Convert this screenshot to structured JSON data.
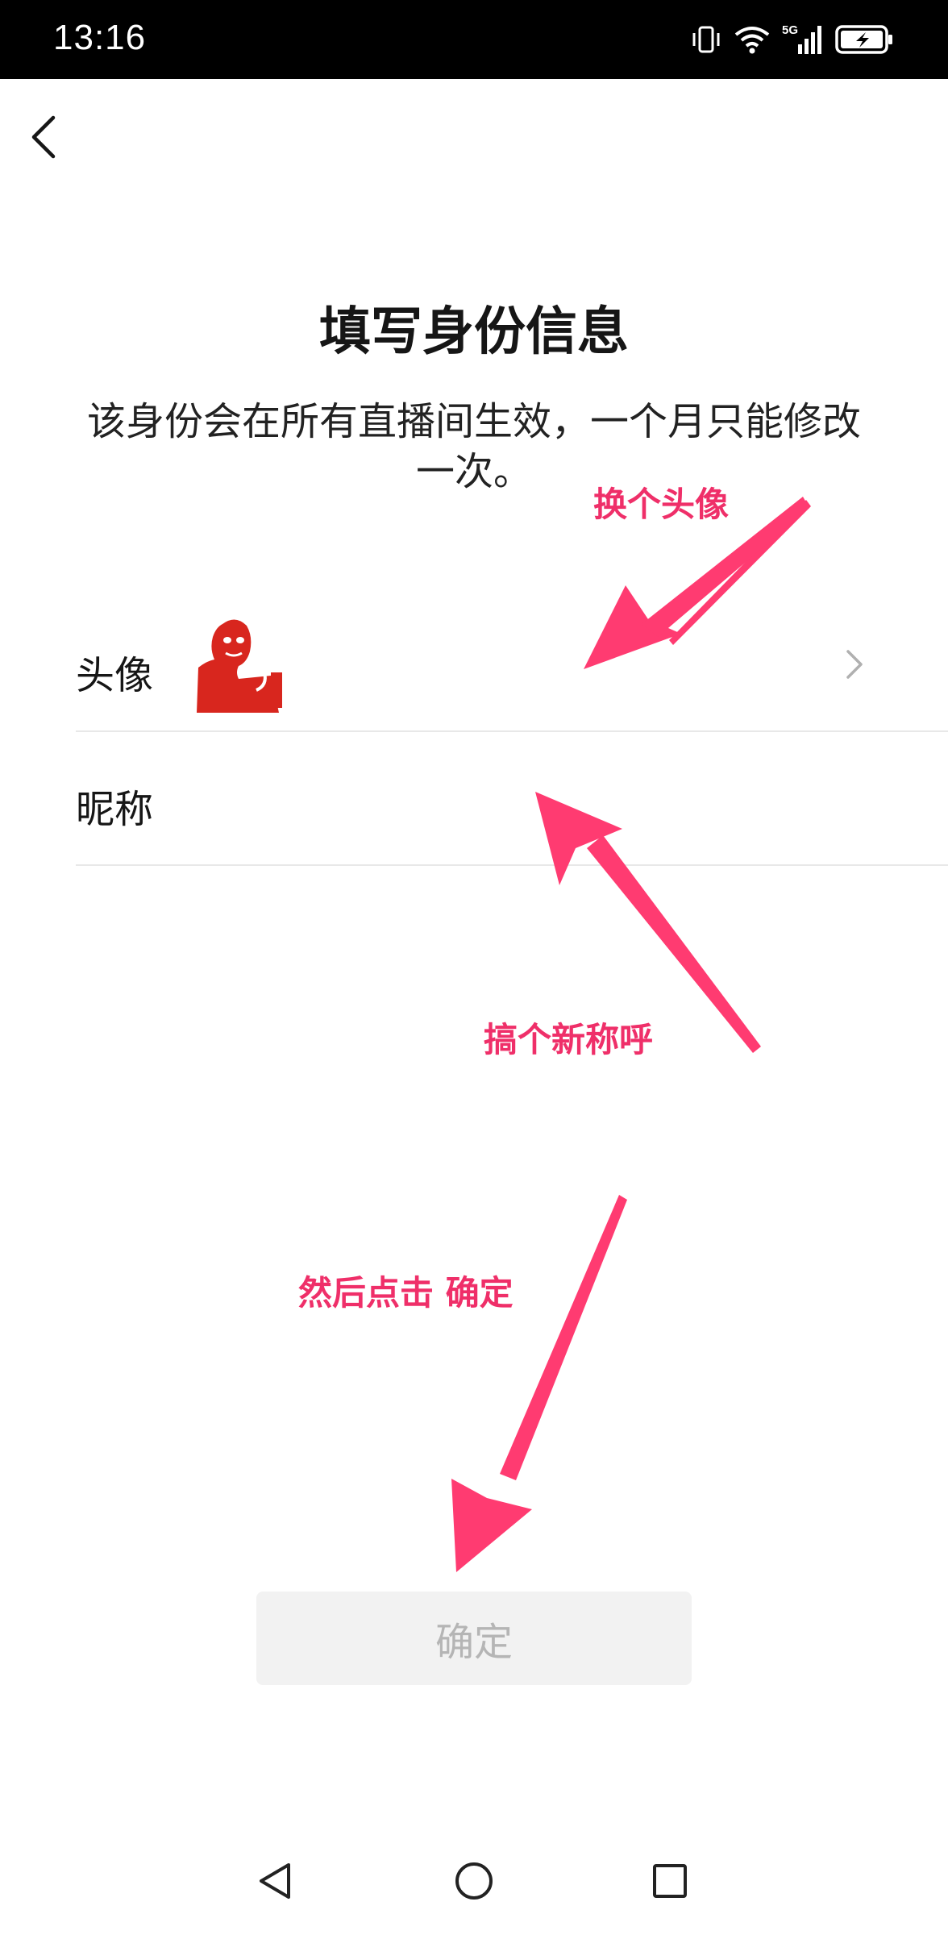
{
  "status_bar": {
    "time": "13:16",
    "icons": [
      "vibrate-icon",
      "wifi-icon",
      "signal-5g-icon",
      "battery-charging-icon"
    ],
    "network_label": "5G"
  },
  "header": {
    "back_icon": "chevron-left-icon"
  },
  "main": {
    "title": "填写身份信息",
    "description": "该身份会在所有直播间生效，一个月只能修改一次。",
    "rows": [
      {
        "label": "头像",
        "value_type": "avatar-image",
        "trailing_icon": "chevron-right-icon"
      },
      {
        "label": "昵称",
        "value": ""
      }
    ],
    "confirm_label": "确定"
  },
  "annotations": {
    "avatar_hint": "换个头像",
    "nickname_hint": "搞个新称呼",
    "confirm_hint": "然后点击 确定",
    "color": "#ef2f69"
  },
  "nav_bar": {
    "icons": [
      "back-triangle-icon",
      "home-circle-icon",
      "recent-square-icon"
    ]
  },
  "colors": {
    "annotation": "#ef2f69",
    "button_bg": "#f2f2f2",
    "button_text": "#b5b5b5",
    "divider": "#e8e8e8"
  }
}
